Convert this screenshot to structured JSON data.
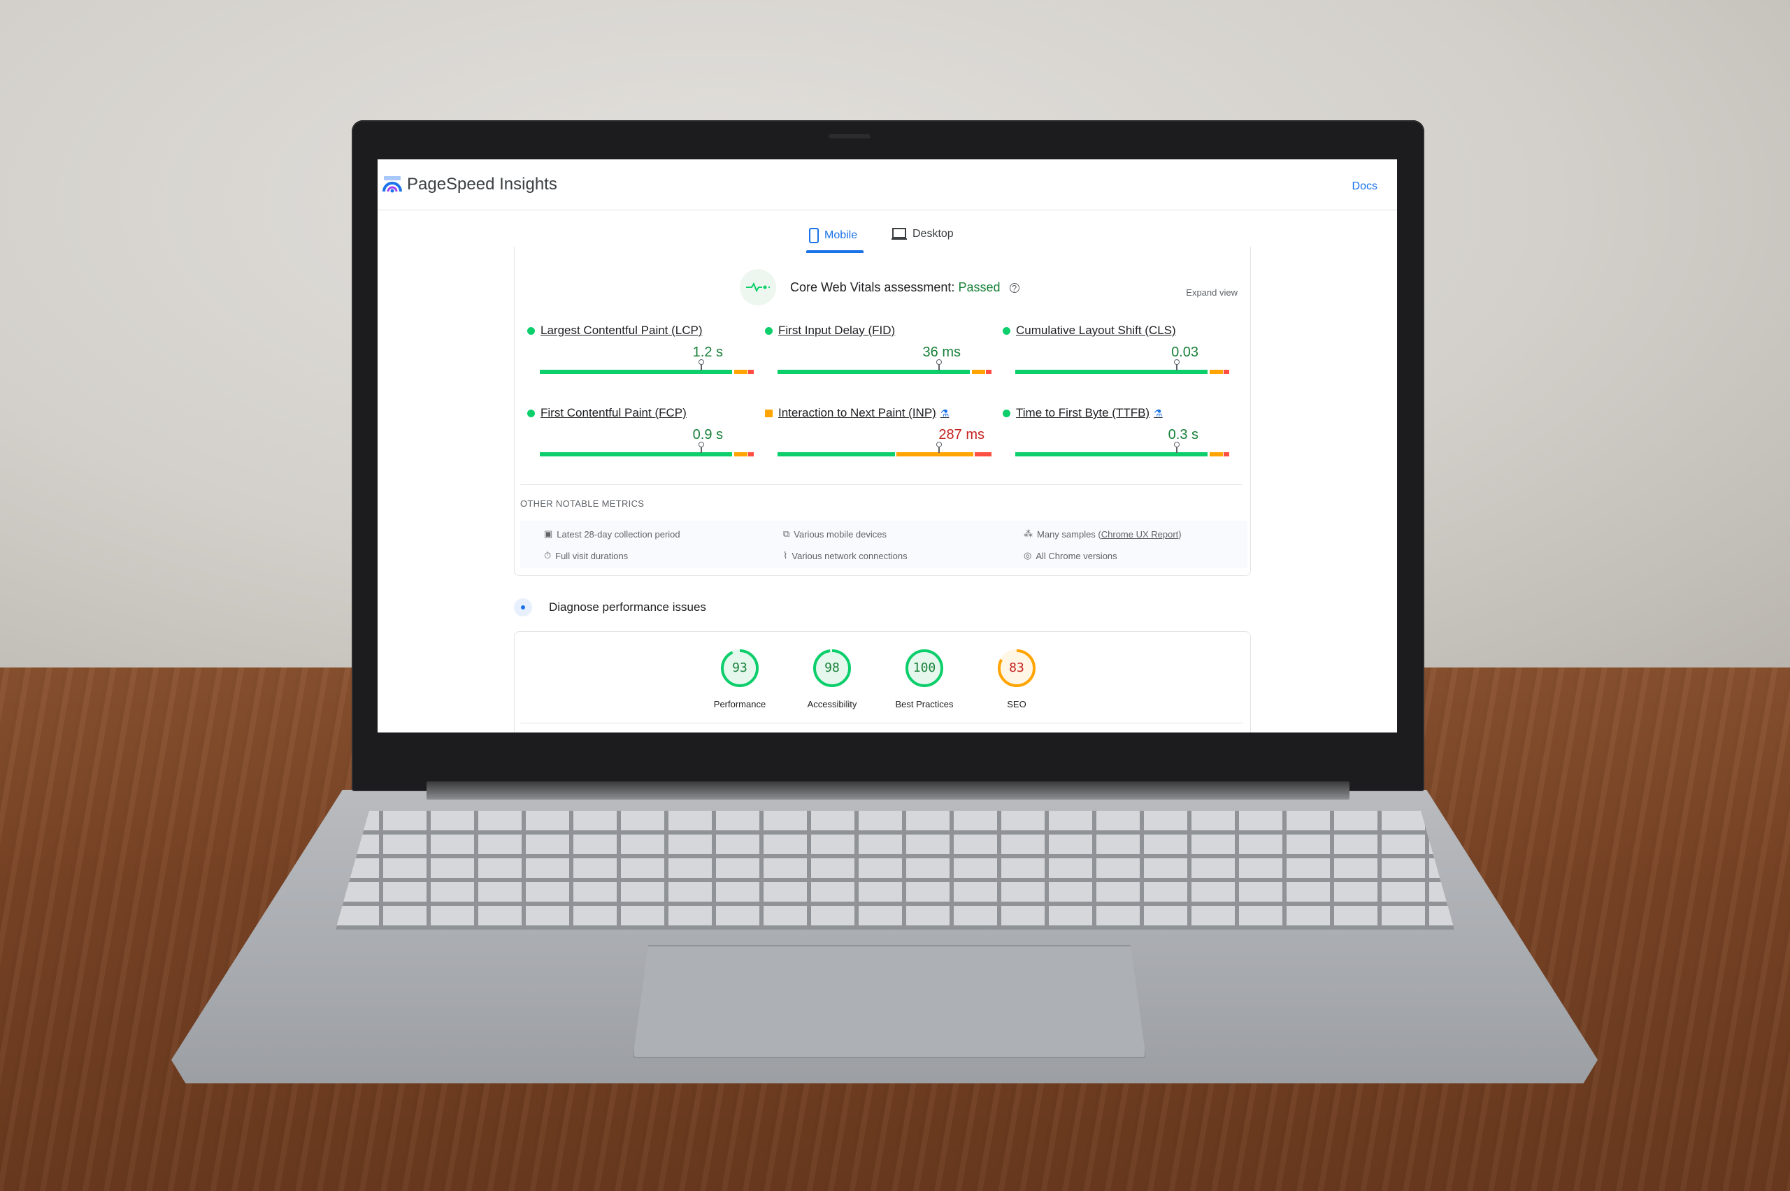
{
  "app": {
    "title": "PageSpeed Insights",
    "docs_label": "Docs"
  },
  "tabs": [
    {
      "label": "Mobile",
      "active": true
    },
    {
      "label": "Desktop",
      "active": false
    }
  ],
  "cwv": {
    "assessment_label": "Core Web Vitals assessment:",
    "status": "Passed",
    "expand_label": "Expand view"
  },
  "core_metrics": [
    {
      "label": "Largest Contentful Paint (LCP)",
      "value": "1.2 s",
      "rating": "good",
      "marker_pct": 75,
      "experimental": false
    },
    {
      "label": "First Input Delay (FID)",
      "value": "36 ms",
      "rating": "good",
      "marker_pct": 75,
      "experimental": false
    },
    {
      "label": "Cumulative Layout Shift (CLS)",
      "value": "0.03",
      "rating": "good",
      "marker_pct": 75,
      "experimental": false
    }
  ],
  "other_label": "OTHER NOTABLE METRICS",
  "other_metrics": [
    {
      "label": "First Contentful Paint (FCP)",
      "value": "0.9 s",
      "rating": "good",
      "marker_pct": 75,
      "experimental": false
    },
    {
      "label": "Interaction to Next Paint (INP)",
      "value": "287 ms",
      "rating": "needs-improvement",
      "marker_pct": 75,
      "experimental": true
    },
    {
      "label": "Time to First Byte (TTFB)",
      "value": "0.3 s",
      "rating": "good",
      "marker_pct": 75,
      "experimental": true
    }
  ],
  "info": {
    "period": "Latest 28-day collection period",
    "devices": "Various mobile devices",
    "samples_prefix": "Many samples (",
    "samples_link": "Chrome UX Report",
    "samples_suffix": ")",
    "durations": "Full visit durations",
    "network": "Various network connections",
    "chrome": "All Chrome versions"
  },
  "diagnose": {
    "label": "Diagnose performance issues"
  },
  "scores": [
    {
      "label": "Performance",
      "value": "93",
      "score": 93,
      "color": "#0cce6b",
      "text_color": "#188038"
    },
    {
      "label": "Accessibility",
      "value": "98",
      "score": 98,
      "color": "#0cce6b",
      "text_color": "#188038"
    },
    {
      "label": "Best Practices",
      "value": "100",
      "score": 100,
      "color": "#0cce6b",
      "text_color": "#188038"
    },
    {
      "label": "SEO",
      "value": "83",
      "score": 83,
      "color": "#ffa400",
      "text_color": "#c5221f"
    }
  ],
  "colors": {
    "good": "#0cce6b",
    "ni": "#ffa400",
    "poor": "#ff4e42",
    "good_text": "#188038",
    "ni_text": "#c5221f",
    "accent": "#1a73e8"
  }
}
